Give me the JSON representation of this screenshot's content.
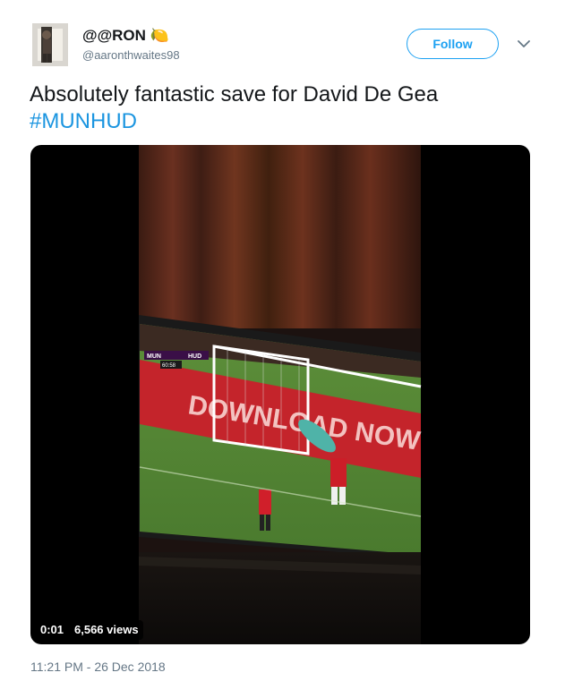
{
  "tweet": {
    "display_name": "@@RON",
    "display_name_emoji": "🍋",
    "handle": "@aaronthwaites98",
    "follow_label": "Follow",
    "text": "Absolutely fantastic save for David De Gea",
    "hashtag": "#MUNHUD",
    "timestamp": "11:21 PM - 26 Dec 2018"
  },
  "video": {
    "elapsed": "0:01",
    "views": "6,566 views",
    "scoreboard": {
      "home": "MUN",
      "away": "HUD",
      "clock": "60:58"
    },
    "ad_board_text": "DOWNLOAD NOW"
  },
  "colors": {
    "accent": "#1da1f2",
    "hashtag": "#1b95e0",
    "muted": "#657786"
  },
  "icons": {
    "caret": "chevron-down-icon",
    "lemon": "lemon-emoji"
  }
}
